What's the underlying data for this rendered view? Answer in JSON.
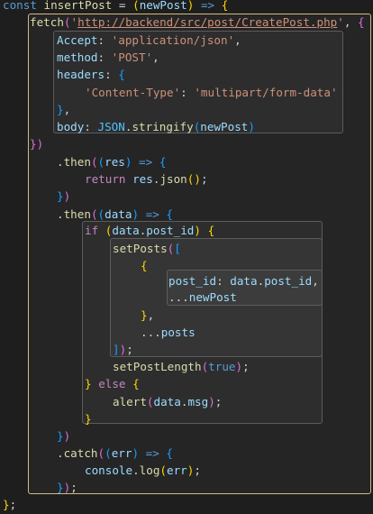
{
  "code": {
    "l1": {
      "kw": "const",
      "name": "insertPost",
      "eq": " = ",
      "param": "newPost",
      "arrow": " => "
    },
    "l2": {
      "fn": "fetch",
      "url": "http://backend/src/post/CreatePost.php"
    },
    "l3": {
      "key": "Accept",
      "val": "'application/json'"
    },
    "l4": {
      "key": "method",
      "val": "'POST'"
    },
    "l5": {
      "key": "headers"
    },
    "l6": {
      "key": "'Content-Type'",
      "val": "'multipart/form-data'"
    },
    "l8": {
      "key": "body",
      "obj": "JSON",
      "fn": "stringify",
      "arg": "newPost"
    },
    "l10": {
      "fn": "then",
      "arg": "res"
    },
    "l11": {
      "kw": "return",
      "obj": "res",
      "fn": "json"
    },
    "l13": {
      "fn": "then",
      "arg": "data"
    },
    "l14": {
      "kw": "if",
      "obj": "data",
      "prop": "post_id"
    },
    "l15": {
      "fn": "setPosts"
    },
    "l17": {
      "key": "post_id",
      "obj": "data",
      "prop": "post_id"
    },
    "l18": {
      "spread": "...",
      "arg": "newPost"
    },
    "l20": {
      "spread": "...",
      "arg": "posts"
    },
    "l22": {
      "fn": "setPostLength",
      "arg": "true"
    },
    "l23": {
      "kw": "else"
    },
    "l24": {
      "fn": "alert",
      "obj": "data",
      "prop": "msg"
    },
    "l27": {
      "fn": "catch",
      "arg": "err"
    },
    "l28": {
      "obj": "console",
      "fn": "log",
      "arg": "err"
    }
  }
}
